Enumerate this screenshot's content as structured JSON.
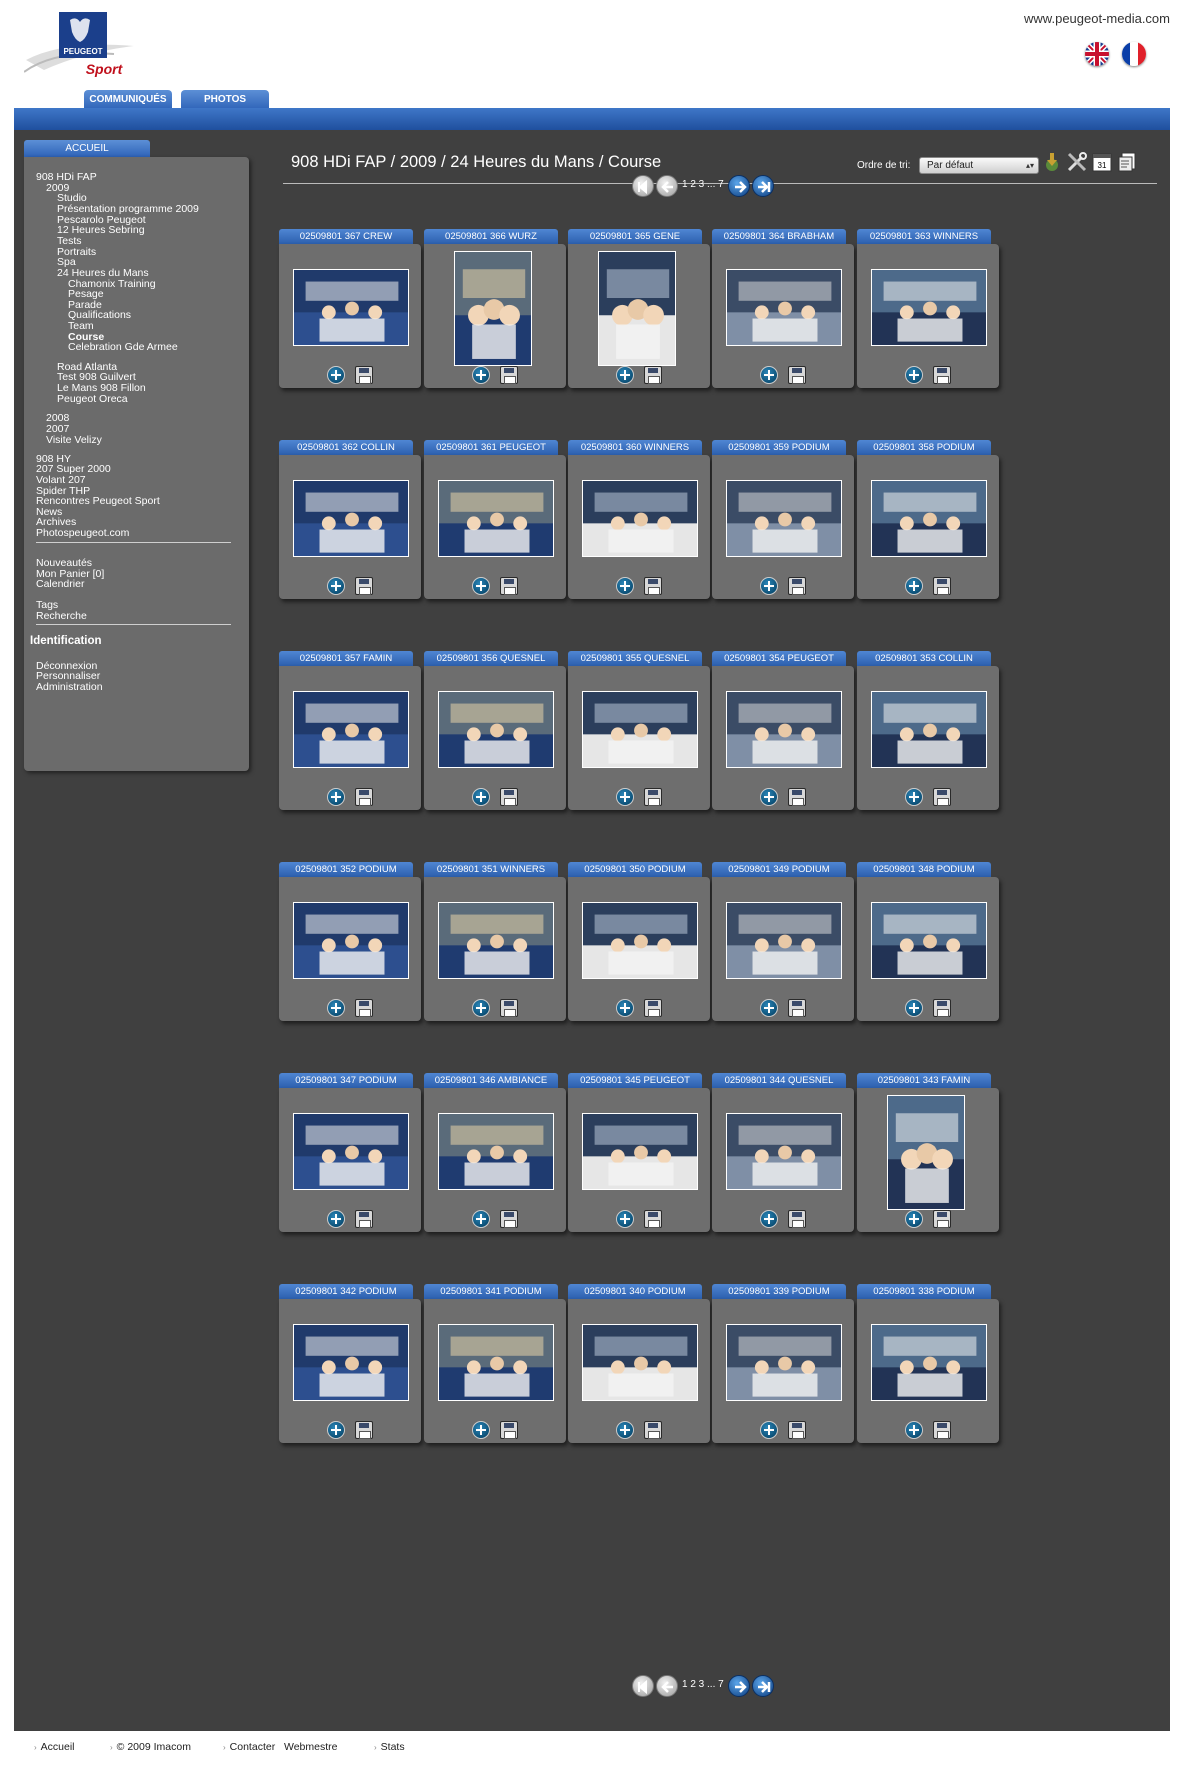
{
  "header": {
    "site_url": "www.peugeot-media.com",
    "logo_brand": "PEUGEOT",
    "logo_sub": "Sport",
    "tabs": [
      "COMMUNIQUÉS",
      "PHOTOS"
    ],
    "flags": [
      "uk-flag-icon",
      "fr-flag-icon"
    ]
  },
  "sidebar": {
    "home_tab": "ACCUEIL",
    "tree": {
      "root": "908 HDi FAP",
      "year": "2009",
      "l2": [
        "Studio",
        "Présentation programme 2009",
        "Pescarolo Peugeot",
        "12 Heures Sebring",
        "Tests",
        "Portraits",
        "Spa",
        "24 Heures du Mans"
      ],
      "l3": [
        "Chamonix Training",
        "Pesage",
        "Parade",
        "Qualifications",
        "Team",
        "Course",
        "Celebration Gde Armee"
      ],
      "l2b": [
        "Road Atlanta",
        "Test 908 Guilvert",
        "Le Mans 908 Fillon",
        "Peugeot Oreca"
      ],
      "years": [
        "2008",
        "2007",
        "Visite Velizy"
      ],
      "others": [
        "908 HY",
        "207 Super 2000",
        "Volant 207",
        "Spider THP",
        "Rencontres Peugeot Sport",
        "News",
        "Archives",
        "Photospeugeot.com"
      ]
    },
    "links1": [
      "Nouveautés",
      "Mon Panier [0]",
      "Calendrier"
    ],
    "links2": [
      "Tags",
      "Recherche"
    ],
    "identification": "Identification",
    "links3": [
      "Déconnexion",
      "Personnaliser",
      "Administration"
    ]
  },
  "breadcrumb": "908 HDi FAP / 2009 / 24 Heures du Mans / Course",
  "sort": {
    "label": "Ordre de tri:",
    "value": "Par défaut"
  },
  "tools": [
    "download-icon",
    "tools-icon",
    "calendar-icon",
    "copy-icon"
  ],
  "pager": {
    "pages": "1 2 3 ... 7",
    "current": "1"
  },
  "photos": [
    {
      "title": "02509801 367 CREW",
      "orient": "land"
    },
    {
      "title": "02509801 366 WURZ",
      "orient": "port"
    },
    {
      "title": "02509801 365 GENE",
      "orient": "port"
    },
    {
      "title": "02509801 364 BRABHAM",
      "orient": "land"
    },
    {
      "title": "02509801 363 WINNERS",
      "orient": "land"
    },
    {
      "title": "02509801 362 COLLIN",
      "orient": "land"
    },
    {
      "title": "02509801 361 PEUGEOT",
      "orient": "land"
    },
    {
      "title": "02509801 360 WINNERS",
      "orient": "land"
    },
    {
      "title": "02509801 359 PODIUM",
      "orient": "land"
    },
    {
      "title": "02509801 358 PODIUM",
      "orient": "land"
    },
    {
      "title": "02509801 357 FAMIN",
      "orient": "land"
    },
    {
      "title": "02509801 356 QUESNEL",
      "orient": "land"
    },
    {
      "title": "02509801 355 QUESNEL",
      "orient": "land"
    },
    {
      "title": "02509801 354 PEUGEOT",
      "orient": "land"
    },
    {
      "title": "02509801 353 COLLIN",
      "orient": "land"
    },
    {
      "title": "02509801 352 PODIUM",
      "orient": "land"
    },
    {
      "title": "02509801 351 WINNERS",
      "orient": "land"
    },
    {
      "title": "02509801 350 PODIUM",
      "orient": "land"
    },
    {
      "title": "02509801 349 PODIUM",
      "orient": "land"
    },
    {
      "title": "02509801 348 PODIUM",
      "orient": "land"
    },
    {
      "title": "02509801 347 PODIUM",
      "orient": "land"
    },
    {
      "title": "02509801 346 AMBIANCE",
      "orient": "land"
    },
    {
      "title": "02509801 345 PEUGEOT",
      "orient": "land"
    },
    {
      "title": "02509801 344 QUESNEL",
      "orient": "land"
    },
    {
      "title": "02509801 343 FAMIN",
      "orient": "port"
    },
    {
      "title": "02509801 342 PODIUM",
      "orient": "land"
    },
    {
      "title": "02509801 341 PODIUM",
      "orient": "land"
    },
    {
      "title": "02509801 340 PODIUM",
      "orient": "land"
    },
    {
      "title": "02509801 339 PODIUM",
      "orient": "land"
    },
    {
      "title": "02509801 338 PODIUM",
      "orient": "land"
    }
  ],
  "footer": [
    "Accueil",
    "© 2009 Imacom",
    "Contacter",
    "Webmestre",
    "Stats"
  ],
  "colors": {
    "accent": "#2e63b8",
    "panel": "#404040",
    "card": "#6e6e6e"
  }
}
